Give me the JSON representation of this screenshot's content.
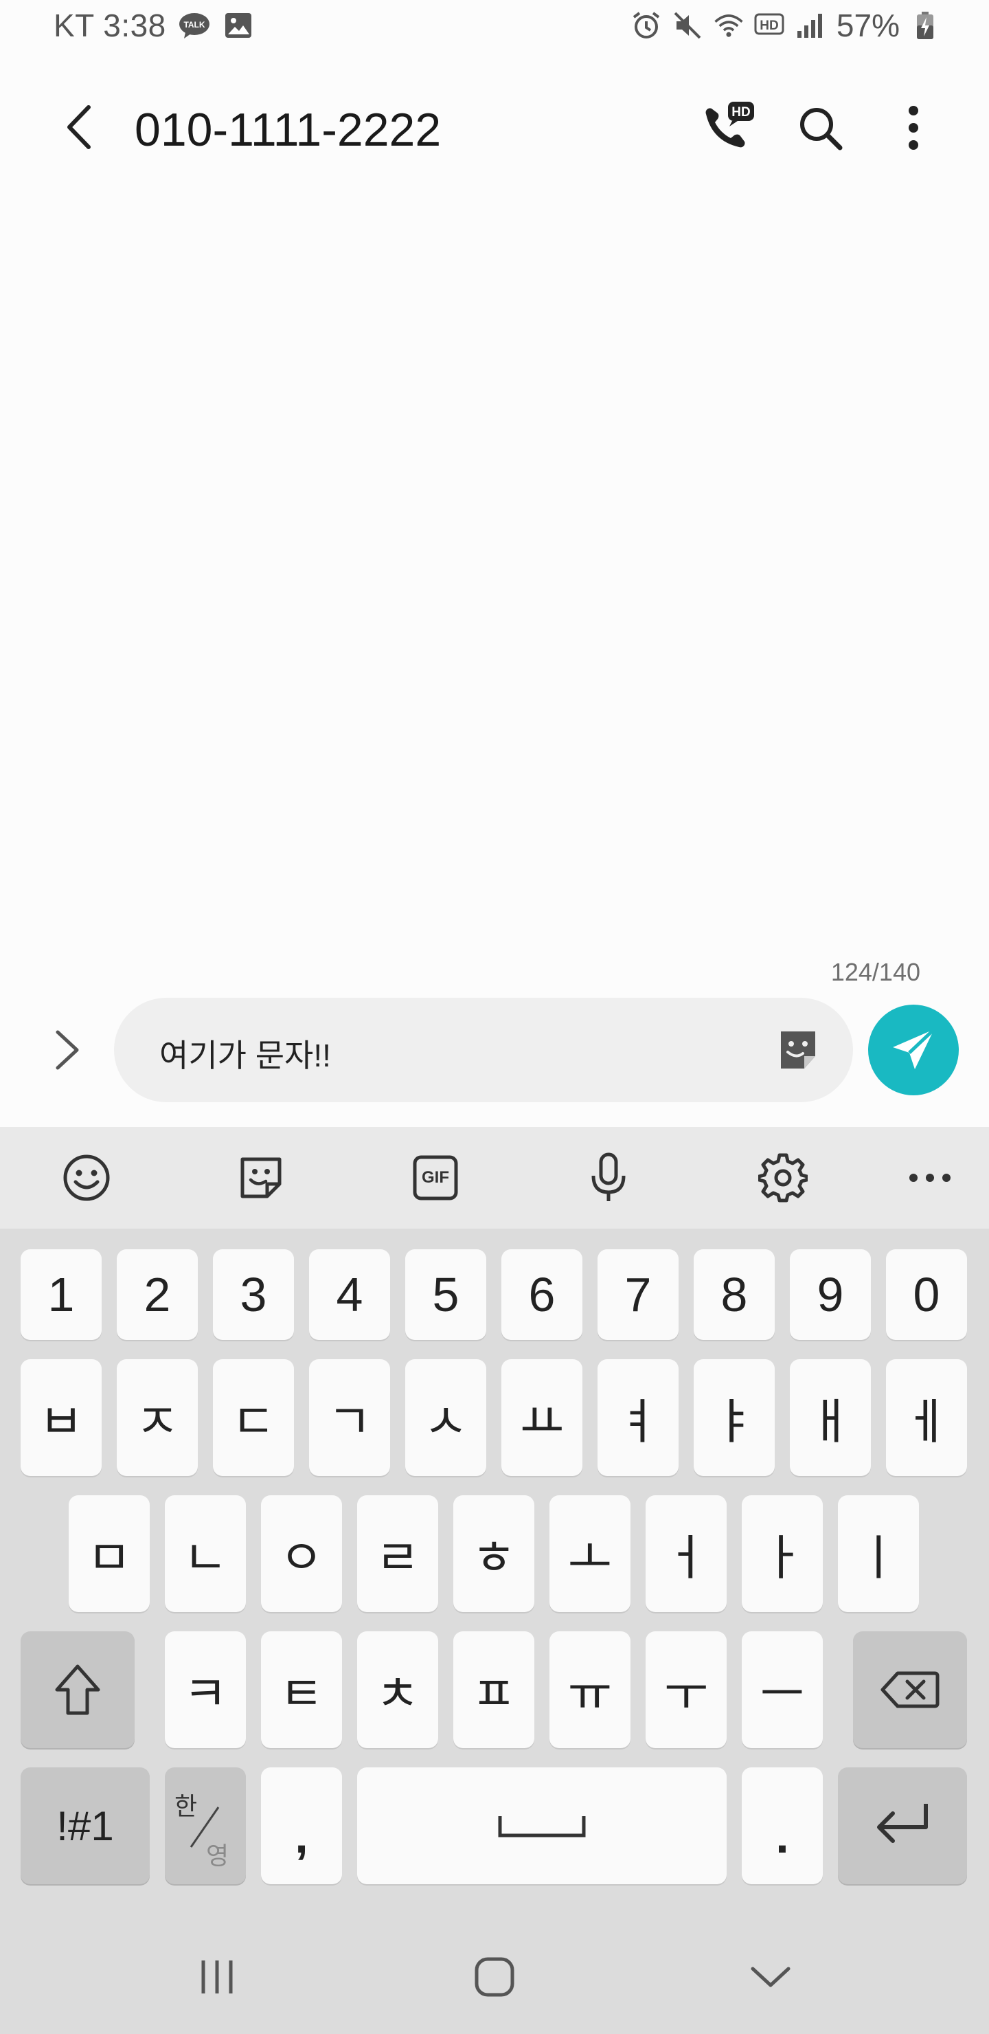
{
  "status_bar": {
    "time": "KT 3:38",
    "battery": "57%",
    "icons": [
      "talk-icon",
      "gallery-icon",
      "alarm-icon",
      "mute-icon",
      "wifi-icon",
      "hd-voice-icon",
      "signal-icon",
      "battery-charging-icon"
    ]
  },
  "app_bar": {
    "title": "010-1111-2222",
    "icons": [
      "back-arrow-icon",
      "hd-call-icon",
      "search-icon",
      "more-vert-icon"
    ]
  },
  "composer": {
    "char_counter": "124/140",
    "message_text": "여기가 문자!!",
    "icons": [
      "expand-chevron-icon",
      "sticker-icon",
      "send-icon"
    ],
    "send_color": "#19b9c2"
  },
  "keyboard": {
    "toolbar_icons": [
      "emoji-icon",
      "sticker-icon",
      "gif-icon",
      "mic-icon",
      "settings-icon",
      "more-horiz-icon"
    ],
    "gif_label": "GIF",
    "row1": [
      "1",
      "2",
      "3",
      "4",
      "5",
      "6",
      "7",
      "8",
      "9",
      "0"
    ],
    "row2": [
      "ㅂ",
      "ㅈ",
      "ㄷ",
      "ㄱ",
      "ㅅ",
      "ㅛ",
      "ㅕ",
      "ㅑ",
      "ㅐ",
      "ㅔ"
    ],
    "row3": [
      "ㅁ",
      "ㄴ",
      "ㅇ",
      "ㄹ",
      "ㅎ",
      "ㅗ",
      "ㅓ",
      "ㅏ",
      "ㅣ"
    ],
    "row4": [
      "ㅋ",
      "ㅌ",
      "ㅊ",
      "ㅍ",
      "ㅠ",
      "ㅜ",
      "ㅡ"
    ],
    "symbols_key": "!#1",
    "lang_key_top": "한",
    "lang_key_bottom": "영",
    "comma_key": ",",
    "period_key": "."
  },
  "nav_bar": {
    "icons": [
      "recents-icon",
      "home-icon",
      "back-chevron-icon"
    ]
  }
}
